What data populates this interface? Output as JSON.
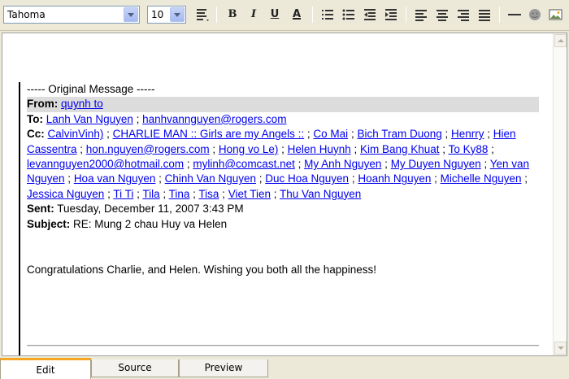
{
  "toolbar": {
    "font_family": "Tahoma",
    "font_size": "10",
    "buttons": {
      "bold": "B",
      "italic": "I",
      "underline": "U",
      "font_color": "A"
    }
  },
  "message": {
    "original_header": "----- Original Message -----",
    "from_label": "From:",
    "from": "quynh to",
    "to_label": "To:",
    "to": [
      "Lanh Van Nguyen",
      "hanhvannguyen@rogers.com"
    ],
    "cc_label": "Cc:",
    "cc": [
      "CalvinVinh)",
      "CHARLIE MAN :: Girls are my Angels ::",
      "Co Mai",
      "Bich Tram Duong",
      "Henrry",
      "Hien Cassentra",
      "hon.nguyen@rogers.com",
      "Hong vo Le)",
      "Helen Huynh",
      "Kim Bang Khuat",
      "To Ky88",
      "levannguyen2000@hotmail.com",
      "mylinh@comcast.net",
      "My Anh Nguyen",
      "My Duyen Nguyen",
      "Yen van Nguyen",
      "Hoa van Nguyen",
      "Chinh Van Nguyen",
      "Duc Hoa Nguyen",
      "Hoanh Nguyen",
      "Michelle Nguyen",
      "Jessica Nguyen",
      "Ti Ti",
      "Tila",
      "Tina",
      "Tisa",
      "Viet Tien",
      "Thu Van Nguyen"
    ],
    "sent_label": "Sent:",
    "sent": "Tuesday, December 11, 2007 3:43 PM",
    "subject_label": "Subject:",
    "subject": "RE: Mung 2 chau Huy va Helen",
    "body": "Congratulations Charlie, and Helen. Wishing you both all the happiness!"
  },
  "tabs": [
    {
      "label": "Edit",
      "active": true
    },
    {
      "label": "Source",
      "active": false
    },
    {
      "label": "Preview",
      "active": false
    }
  ],
  "colors": {
    "link": "#0000ee",
    "active_tab_accent": "#f5a623",
    "from_highlight": "#dcdcdc"
  }
}
